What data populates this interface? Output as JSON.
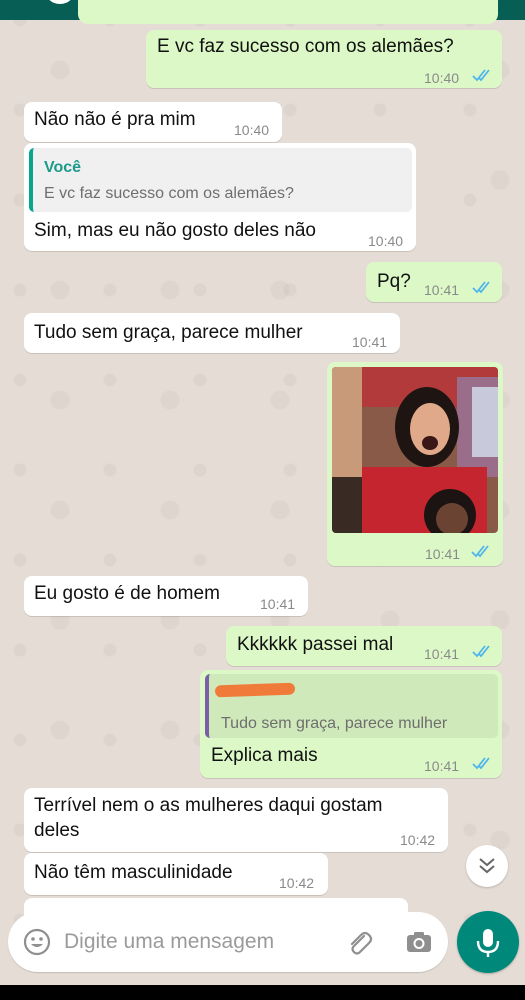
{
  "composer": {
    "placeholder": "Digite uma mensagem"
  },
  "messages": [
    {
      "dir": "out",
      "text": "E vc faz sucesso com os alemães?",
      "time": "10:40",
      "status": "read"
    },
    {
      "dir": "in",
      "text": "Não não é pra mim",
      "time": "10:40"
    },
    {
      "dir": "in",
      "quote_author": "Você",
      "quote_text": "E vc faz sucesso com os alemães?",
      "text": "Sim, mas eu não gosto deles não",
      "time": "10:40"
    },
    {
      "dir": "out",
      "text": "Pq?",
      "time": "10:41",
      "status": "read"
    },
    {
      "dir": "in",
      "text": "Tudo sem graça, parece mulher",
      "time": "10:41"
    },
    {
      "dir": "out",
      "type": "image",
      "time": "10:41",
      "status": "read"
    },
    {
      "dir": "in",
      "text": "Eu gosto é de homem",
      "time": "10:41"
    },
    {
      "dir": "out",
      "text": "Kkkkkk passei mal",
      "time": "10:41",
      "status": "read"
    },
    {
      "dir": "out",
      "quote_text": "Tudo sem graça, parece mulher",
      "text": "Explica mais",
      "time": "10:41",
      "status": "read"
    },
    {
      "dir": "in",
      "text_line1": "Terrível nem o as mulheres daqui gostam",
      "text_line2": "deles",
      "time": "10:42"
    },
    {
      "dir": "in",
      "text": "Não têm masculinidade",
      "time": "10:42"
    }
  ],
  "colors": {
    "header": "#075e54",
    "outgoing_bubble": "#dcf8c6",
    "incoming_bubble": "#ffffff",
    "read_ticks": "#4fb6ec",
    "mic_button": "#00897b"
  },
  "icons": [
    "emoji-icon",
    "attach-icon",
    "camera-icon",
    "mic-icon",
    "scroll-down-icon",
    "read-receipt-icon"
  ]
}
